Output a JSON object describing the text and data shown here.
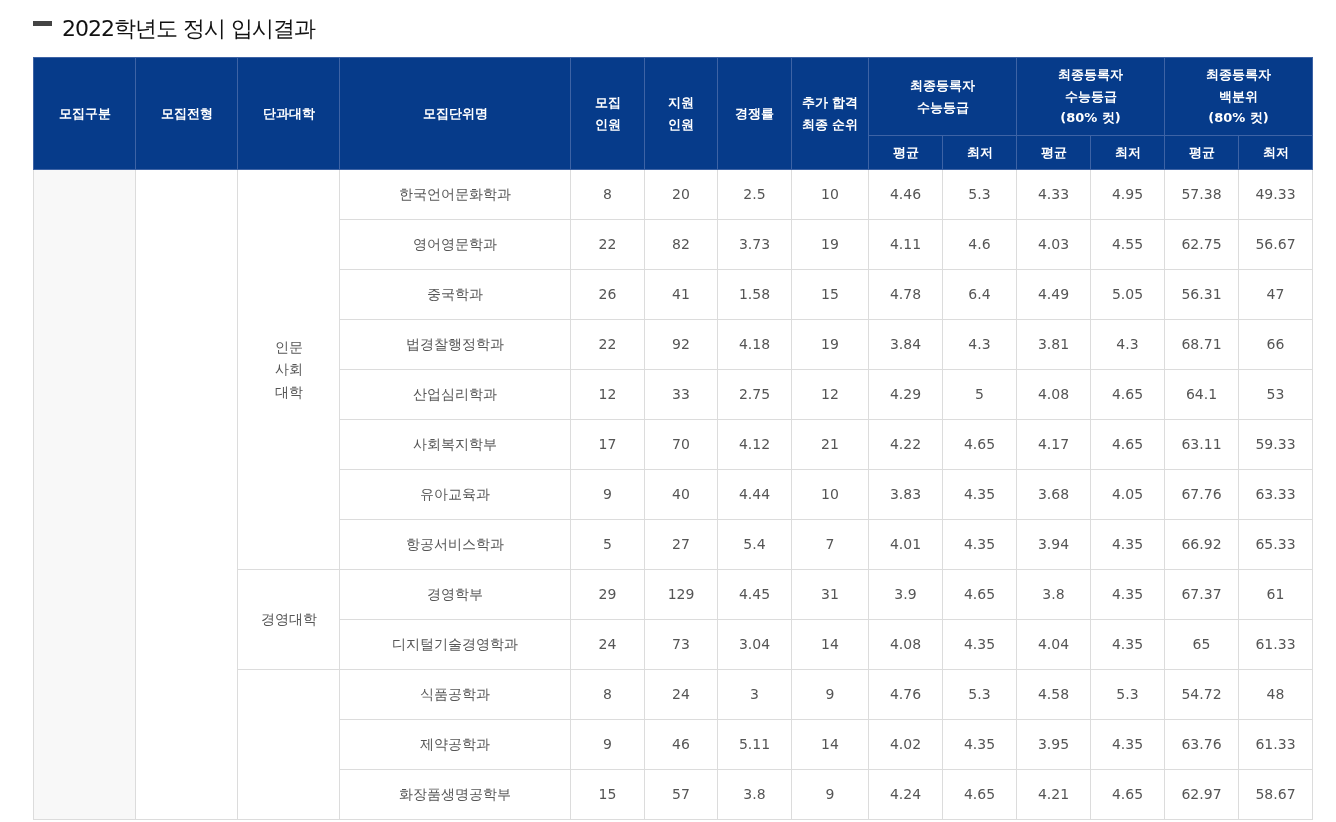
{
  "title": "2022학년도 정시 입시결과",
  "table": {
    "columns": [
      {
        "label": "모집구분"
      },
      {
        "label": "모집전형"
      },
      {
        "label": "단과대학"
      },
      {
        "label": "모집단위명"
      },
      {
        "label": "모집\n인원"
      },
      {
        "label": "지원\n인원"
      },
      {
        "label": "경쟁률"
      },
      {
        "label": "추가 합격\n최종 순위"
      },
      {
        "label": "최종등록자\n수능등급",
        "sub": [
          "평균",
          "최저"
        ]
      },
      {
        "label": "최종등록자\n수능등급\n(80% 컷)",
        "sub": [
          "평균",
          "최저"
        ]
      },
      {
        "label": "최종등록자\n백분위\n(80% 컷)",
        "sub": [
          "평균",
          "최저"
        ]
      }
    ],
    "groups": [
      {
        "college": "인문\n사회\n대학",
        "rows": [
          {
            "unit": "한국언어문화학과",
            "values": [
              "8",
              "20",
              "2.5",
              "10",
              "4.46",
              "5.3",
              "4.33",
              "4.95",
              "57.38",
              "49.33"
            ]
          },
          {
            "unit": "영어영문학과",
            "values": [
              "22",
              "82",
              "3.73",
              "19",
              "4.11",
              "4.6",
              "4.03",
              "4.55",
              "62.75",
              "56.67"
            ]
          },
          {
            "unit": "중국학과",
            "values": [
              "26",
              "41",
              "1.58",
              "15",
              "4.78",
              "6.4",
              "4.49",
              "5.05",
              "56.31",
              "47"
            ]
          },
          {
            "unit": "법경찰행정학과",
            "values": [
              "22",
              "92",
              "4.18",
              "19",
              "3.84",
              "4.3",
              "3.81",
              "4.3",
              "68.71",
              "66"
            ]
          },
          {
            "unit": "산업심리학과",
            "values": [
              "12",
              "33",
              "2.75",
              "12",
              "4.29",
              "5",
              "4.08",
              "4.65",
              "64.1",
              "53"
            ]
          },
          {
            "unit": "사회복지학부",
            "values": [
              "17",
              "70",
              "4.12",
              "21",
              "4.22",
              "4.65",
              "4.17",
              "4.65",
              "63.11",
              "59.33"
            ]
          },
          {
            "unit": "유아교육과",
            "values": [
              "9",
              "40",
              "4.44",
              "10",
              "3.83",
              "4.35",
              "3.68",
              "4.05",
              "67.76",
              "63.33"
            ]
          },
          {
            "unit": "항공서비스학과",
            "values": [
              "5",
              "27",
              "5.4",
              "7",
              "4.01",
              "4.35",
              "3.94",
              "4.35",
              "66.92",
              "65.33"
            ]
          }
        ]
      },
      {
        "college": "경영대학",
        "rows": [
          {
            "unit": "경영학부",
            "values": [
              "29",
              "129",
              "4.45",
              "31",
              "3.9",
              "4.65",
              "3.8",
              "4.35",
              "67.37",
              "61"
            ]
          },
          {
            "unit": "디지털기술경영학과",
            "values": [
              "24",
              "73",
              "3.04",
              "14",
              "4.08",
              "4.35",
              "4.04",
              "4.35",
              "65",
              "61.33"
            ]
          }
        ]
      },
      {
        "rows": [
          {
            "unit": "식품공학과",
            "values": [
              "8",
              "24",
              "3",
              "9",
              "4.76",
              "5.3",
              "4.58",
              "5.3",
              "54.72",
              "48"
            ]
          },
          {
            "unit": "제약공학과",
            "values": [
              "9",
              "46",
              "5.11",
              "14",
              "4.02",
              "4.35",
              "3.95",
              "4.35",
              "63.76",
              "61.33"
            ]
          },
          {
            "unit": "화장품생명공학부",
            "values": [
              "15",
              "57",
              "3.8",
              "9",
              "4.24",
              "4.65",
              "4.21",
              "4.65",
              "62.97",
              "58.67"
            ]
          }
        ]
      }
    ]
  }
}
